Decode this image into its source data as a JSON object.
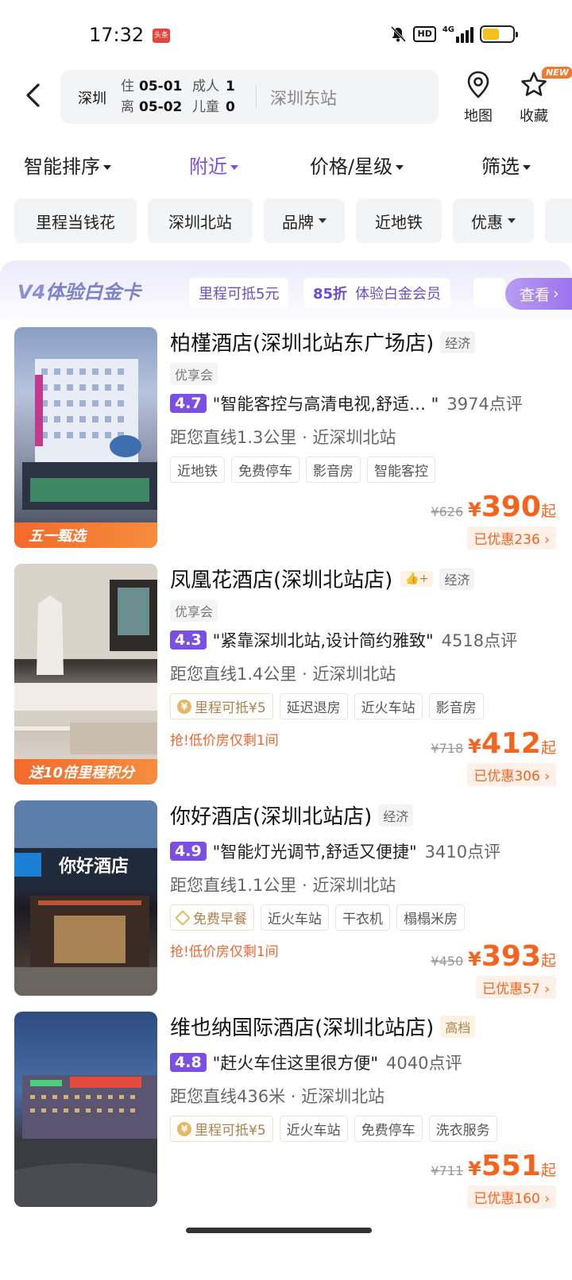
{
  "status_bar": {
    "time": "17:32",
    "app_badge": "头条",
    "network": "4G",
    "hd": "HD"
  },
  "search": {
    "city": "深圳",
    "checkin_label": "住",
    "checkin_date": "05-01",
    "checkout_label": "离",
    "checkout_date": "05-02",
    "adults_label": "成人",
    "adults": "1",
    "children_label": "儿童",
    "children": "0",
    "keyword": "深圳东站"
  },
  "header_actions": {
    "map_label": "地图",
    "fav_label": "收藏",
    "fav_badge": "NEW"
  },
  "sort_bar": [
    {
      "label": "智能排序",
      "active": false
    },
    {
      "label": "附近",
      "active": true
    },
    {
      "label": "价格/星级",
      "active": false
    },
    {
      "label": "筛选",
      "active": false
    }
  ],
  "chips": [
    "里程当钱花",
    "深圳北站",
    "品牌",
    "近地铁",
    "优惠"
  ],
  "promo": {
    "title_v": "V4",
    "title": "体验白金卡",
    "pill1": "里程可抵5元",
    "pill2_bold": "85折",
    "pill2": "体验白金会员",
    "button": "查看"
  },
  "hotels": [
    {
      "name": "柏槿酒店(深圳北站东广场店)",
      "grade": "经济",
      "member": "优享会",
      "score": "4.7",
      "quote": "\"智能客控与高清电视,舒适… \"",
      "reviews": "3974点评",
      "distance": "距您直线1.3公里 · 近深圳北站",
      "tags": [
        "近地铁",
        "免费停车",
        "影音房",
        "智能客控"
      ],
      "ribbon": "五一甄选",
      "original_price": "¥626",
      "price": "390",
      "price_suffix": "起",
      "saved": "已优惠236",
      "urgent": ""
    },
    {
      "name": "凤凰花酒店(深圳北站店)",
      "grade": "经济",
      "thumb_badge": "👍+",
      "member": "优享会",
      "score": "4.3",
      "quote": "\"紧靠深圳北站,设计简约雅致\"",
      "reviews": "4518点评",
      "distance": "距您直线1.4公里 · 近深圳北站",
      "tags": [
        "里程可抵¥5",
        "延迟退房",
        "近火车站",
        "影音房"
      ],
      "ribbon": "送10倍里程积分",
      "urgent": "抢!低价房仅剩1间",
      "original_price": "¥718",
      "price": "412",
      "price_suffix": "起",
      "saved": "已优惠306"
    },
    {
      "name": "你好酒店(深圳北站店)",
      "grade": "经济",
      "score": "4.9",
      "quote": "\"智能灯光调节,舒适又便捷\"",
      "reviews": "3410点评",
      "distance": "距您直线1.1公里 · 近深圳北站",
      "tags": [
        "免费早餐",
        "近火车站",
        "干衣机",
        "榻榻米房"
      ],
      "urgent": "抢!低价房仅剩1间",
      "sign_text": "你好酒店",
      "original_price": "¥450",
      "price": "393",
      "price_suffix": "起",
      "saved": "已优惠57"
    },
    {
      "name": "维也纳国际酒店(深圳北站店)",
      "grade": "高档",
      "score": "4.8",
      "quote": "\"赶火车住这里很方便\"",
      "reviews": "4040点评",
      "distance": "距您直线436米 · 近深圳北站",
      "tags": [
        "里程可抵¥5",
        "近火车站",
        "免费停车",
        "洗衣服务"
      ],
      "original_price": "¥711",
      "price": "551",
      "price_suffix": "起",
      "saved": "已优惠160"
    }
  ],
  "colors": {
    "accent": "#7b4fe0",
    "price": "#f5641e",
    "gold": "#b0814c"
  }
}
